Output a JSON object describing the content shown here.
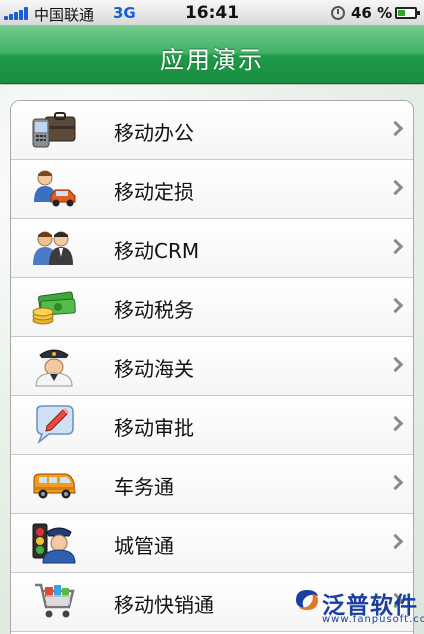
{
  "status_bar": {
    "carrier": "中国联通",
    "network": "3G",
    "time": "16:41",
    "battery": "46 %",
    "battery_level": 0.46,
    "signal_bars": 5
  },
  "header": {
    "title": "应用演示"
  },
  "menu": {
    "items": [
      {
        "label": "移动办公",
        "icon": "briefcase-phone-icon"
      },
      {
        "label": "移动定损",
        "icon": "car-assessor-icon"
      },
      {
        "label": "移动CRM",
        "icon": "people-crm-icon"
      },
      {
        "label": "移动税务",
        "icon": "money-coins-icon"
      },
      {
        "label": "移动海关",
        "icon": "customs-officer-icon"
      },
      {
        "label": "移动审批",
        "icon": "speech-pencil-icon"
      },
      {
        "label": "车务通",
        "icon": "van-icon"
      },
      {
        "label": "城管通",
        "icon": "city-officer-icon"
      },
      {
        "label": "移动快销通",
        "icon": "shopping-cart-icon"
      }
    ]
  },
  "watermark": {
    "brand": "泛普软件",
    "url": "www.fanpusoft.com"
  },
  "colors": {
    "header_green": "#2aa455",
    "network_blue": "#1a5fd0",
    "watermark_blue": "#1a3f9e"
  }
}
